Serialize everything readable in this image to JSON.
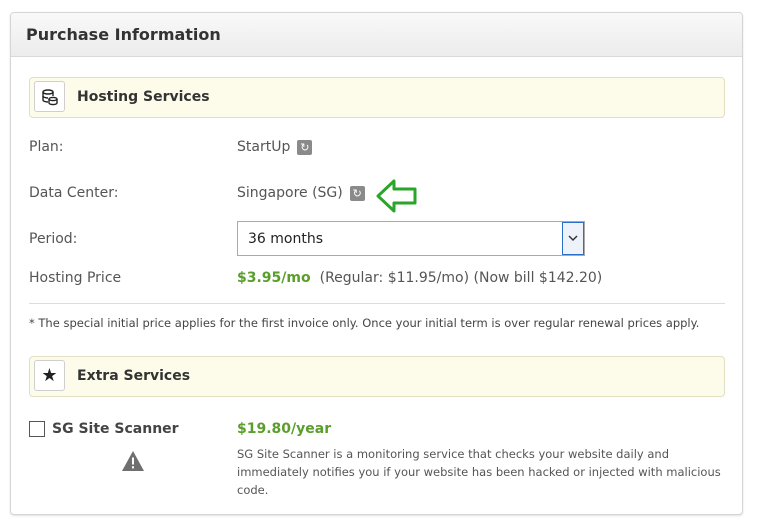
{
  "panel": {
    "title": "Purchase Information"
  },
  "hosting": {
    "section_title": "Hosting Services",
    "plan_label": "Plan:",
    "plan_value": "StartUp",
    "datacenter_label": "Data Center:",
    "datacenter_value": "Singapore (SG)",
    "period_label": "Period:",
    "period_value": "36 months",
    "price_label": "Hosting Price",
    "price_value": "$3.95/mo",
    "price_detail": "(Regular: $11.95/mo) (Now bill $142.20)",
    "note": "* The special initial price applies for the first invoice only. Once your initial term is over regular renewal prices apply."
  },
  "extras": {
    "section_title": "Extra Services",
    "scanner_label": "SG Site Scanner",
    "scanner_checked": false,
    "scanner_price": "$19.80/year",
    "scanner_desc": "SG Site Scanner is a monitoring service that checks your website daily and immediately notifies you if your website has been hacked or injected with malicious code."
  },
  "icons": {
    "hosting": "database-coins-icon",
    "extras": "star-icon",
    "refresh": "refresh-icon",
    "dropdown": "chevron-down-icon",
    "warning": "warning-triangle-icon",
    "annotation": "green-arrow-left-icon"
  },
  "colors": {
    "price_green": "#5a9e2c",
    "section_bg": "#fdfbea",
    "arrow_green": "#2aa52a",
    "select_focus": "#2a6fc9"
  }
}
